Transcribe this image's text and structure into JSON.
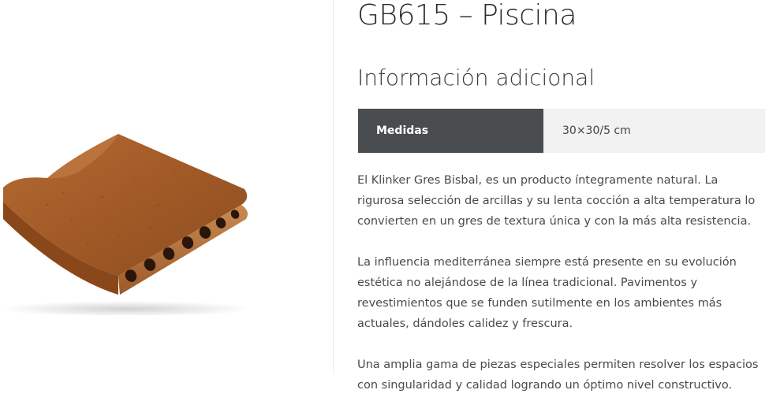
{
  "product": {
    "title": "GB615 – Piscina",
    "image_name": "brick-tile-image"
  },
  "additional_info": {
    "heading": "Información adicional",
    "rows": [
      {
        "label": "Medidas",
        "value": "30×30/5 cm"
      }
    ]
  },
  "description": {
    "paragraphs": [
      "El Klinker Gres Bisbal, es un producto íntegramente natural. La rigurosa selección de arcillas y su lenta cocción a alta temperatura lo convierten en un gres de textura única y con la más alta resistencia.",
      "La influencia mediterránea siempre está presente en su evolución estética no alejándose de la línea tradicional. Pavimentos y revestimientos que se funden sutilmente en los ambientes más actuales, dándoles calidez y frescura.",
      "Una amplia gama de piezas especiales permiten resolver los espacios con singularidad y calidad logrando un óptimo nivel constructivo."
    ]
  },
  "colors": {
    "table_header_bg": "#4a4d50",
    "table_value_bg": "#f2f2f2",
    "tile_main": "#a45d2a"
  }
}
